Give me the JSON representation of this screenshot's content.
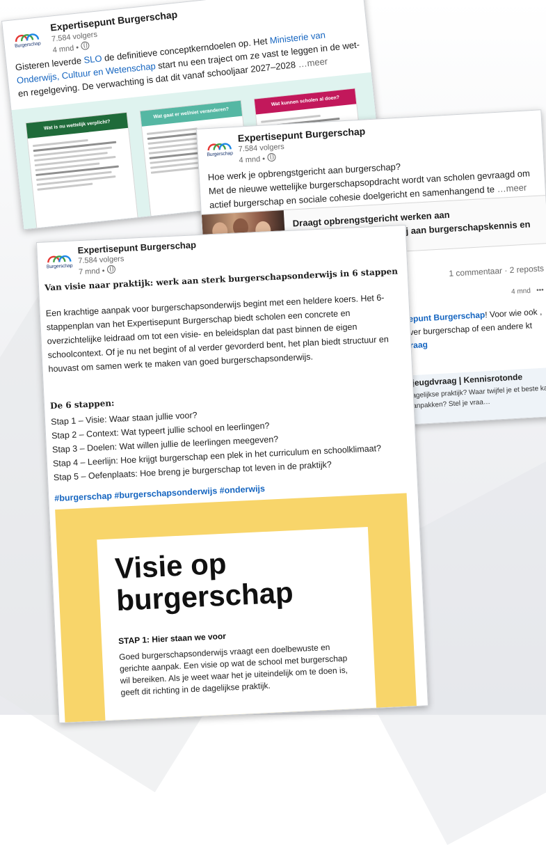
{
  "page": {
    "accent": "#1565c0"
  },
  "posts": {
    "a": {
      "author": "Expertisepunt Burgerschap",
      "followers": "7.584 volgers",
      "time": "4 mnd",
      "logo_text": "Burgerschap",
      "text_before": "Gisteren leverde ",
      "text_link1": "SLO",
      "text_middle": " de definitieve conceptkerndoelen op. Het ",
      "text_link2": "Ministerie van Onderwijs, Cultuur en Wetenschap",
      "text_after": " start nu een traject om ze vast te leggen in de wet- en regelgeving. De verwachting is dat dit vanaf schooljaar 2027–2028",
      "more": "…meer",
      "infographic": {
        "col1": {
          "title": "Wat is nu wettelijk verplicht?",
          "color": "#1f6b3a"
        },
        "col2": {
          "title": "Wat gaat er wel/niet veranderen?",
          "color": "#55b7a3"
        },
        "col3": {
          "title": "Wat kunnen scholen al doen?",
          "color": "#c2185b"
        }
      }
    },
    "b": {
      "author": "Expertisepunt Burgerschap",
      "followers": "7.584 volgers",
      "time": "4 mnd",
      "logo_text": "Burgerschap",
      "line1": "Hoe werk je opbrengstgericht aan burgerschap?",
      "line2": "Met de nieuwe wettelijke burgerschapsopdracht wordt van scholen gevraagd om actief burgerschap en sociale cohesie doelgericht en samenhangend te",
      "more": "…meer",
      "link_title": "Draagt opbrengstgericht werken aan burgerschapsonderwijs bij aan burgerschapskennis en …",
      "stats": "1 commentaar · 2 reposts",
      "comment_time": "4 mnd",
      "comment_more": "•••",
      "comment_link": "sepunt Burgerschap",
      "comment_text": "! Voor wie ook , over burgerschap of een andere kt",
      "comment_action": "vraag",
      "knowledge_title": "/ jeugdvraag | Kennisrotonde",
      "knowledge_desc": "dagelijkse praktijk? Waar twijfel je et beste kan aanpakken? Stel je vraa…"
    },
    "c": {
      "author": "Expertisepunt Burgerschap",
      "followers": "7.584 volgers",
      "time": "7 mnd",
      "logo_text": "Burgerschap",
      "title": "Van visie naar praktijk: werk aan sterk burgerschapsonderwijs in 6 stappen",
      "intro": "Een krachtige aanpak voor burgerschapsonderwijs begint met een heldere koers. Het 6-stappenplan van het Expertisepunt Burgerschap biedt scholen een concrete en overzichtelijke leidraad om tot een visie- en beleidsplan dat past binnen de eigen schoolcontext. Of je nu net begint of al verder gevorderd bent, het plan biedt structuur en houvast om samen werk te maken van goed burgerschapsonderwijs.",
      "steps_heading": "De 6 stappen:",
      "steps": [
        "Stap 1 – Visie: Waar staan jullie voor?",
        "Stap 2 – Context: Wat typeert jullie school en leerlingen?",
        "Stap 3 – Doelen: Wat willen jullie de leerlingen meegeven?",
        "Stap 4 – Leerlijn: Hoe krijgt burgerschap een plek in het curriculum en schoolklimaat?",
        "Stap 5 – Oefenplaats: Hoe breng je burgerschap tot leven in de praktijk?"
      ],
      "hashtags": "#burgerschap #burgerschapsonderwijs #onderwijs",
      "image": {
        "title": "Visie op burgerschap",
        "step_label": "STAP 1: Hier staan we voor",
        "step_body": "Goed burgerschapsonderwijs vraagt een doelbewuste en gerichte aanpak. Een visie op wat de school met burgerschap wil bereiken. Als je weet waar het je uiteindelijk om te doen is, geeft dit richting in de dagelijkse praktijk."
      }
    }
  }
}
